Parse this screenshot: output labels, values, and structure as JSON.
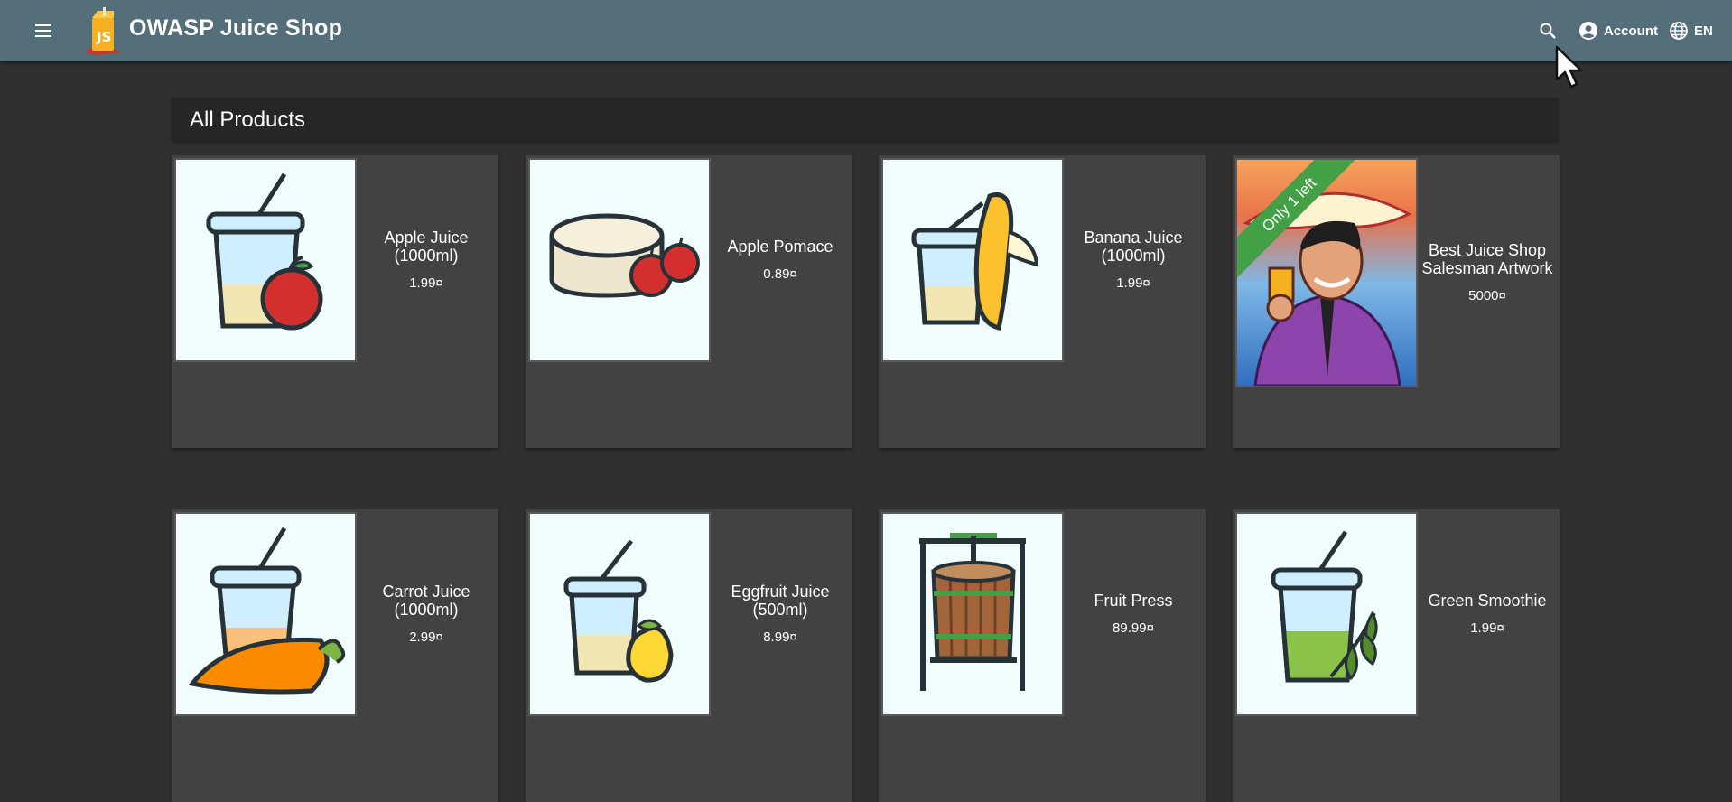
{
  "header": {
    "title": "OWASP Juice Shop",
    "account_label": "Account",
    "language_label": "EN"
  },
  "section": {
    "title": "All Products"
  },
  "products": [
    {
      "name": "Apple Juice (1000ml)",
      "price": "1.99¤"
    },
    {
      "name": "Apple Pomace",
      "price": "0.89¤"
    },
    {
      "name": "Banana Juice (1000ml)",
      "price": "1.99¤"
    },
    {
      "name": "Best Juice Shop Salesman Artwork",
      "price": "5000¤",
      "badge": "Only 1 left"
    },
    {
      "name": "Carrot Juice (1000ml)",
      "price": "2.99¤"
    },
    {
      "name": "Eggfruit Juice (500ml)",
      "price": "8.99¤"
    },
    {
      "name": "Fruit Press",
      "price": "89.99¤"
    },
    {
      "name": "Green Smoothie",
      "price": "1.99¤"
    }
  ],
  "colors": {
    "toolbar": "#546e7a",
    "background": "#303030",
    "card": "#424242",
    "badge": "#43a047"
  },
  "icons": [
    "menu-icon",
    "juice-shop-logo",
    "search-icon",
    "account-circle-icon",
    "language-icon",
    "mouse-cursor"
  ]
}
